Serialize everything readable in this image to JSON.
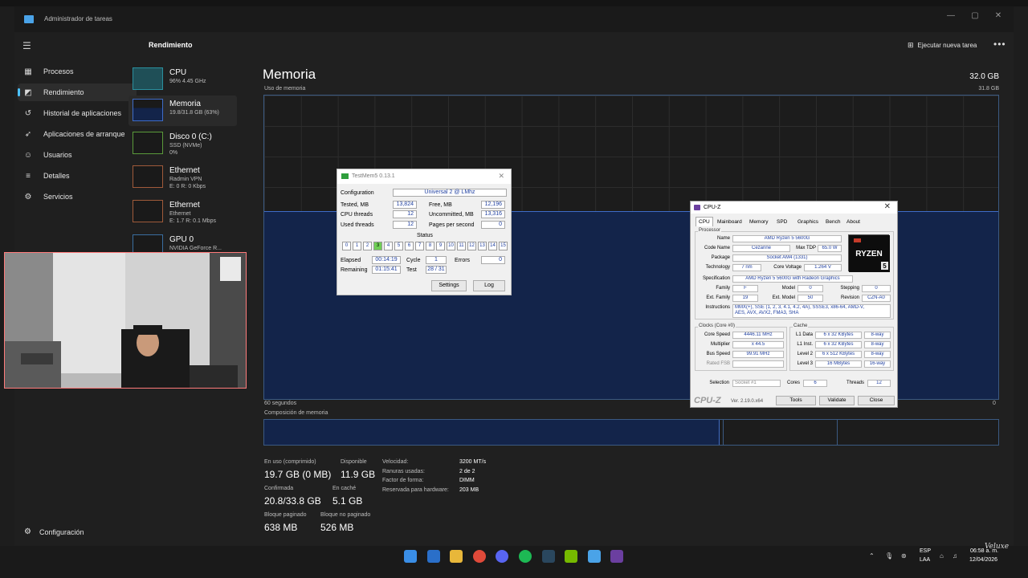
{
  "window": {
    "title": "Administrador de tareas",
    "minimize": "—",
    "maximize": "▢",
    "close": "✕"
  },
  "nav": {
    "items": [
      {
        "label": "Procesos",
        "icon": "processes-icon"
      },
      {
        "label": "Rendimiento",
        "icon": "performance-icon",
        "active": true
      },
      {
        "label": "Historial de aplicaciones",
        "icon": "history-icon"
      },
      {
        "label": "Aplicaciones de arranque",
        "icon": "startup-icon"
      },
      {
        "label": "Usuarios",
        "icon": "users-icon"
      },
      {
        "label": "Detalles",
        "icon": "details-icon"
      },
      {
        "label": "Servicios",
        "icon": "services-icon"
      }
    ],
    "settings": "Configuración"
  },
  "header": {
    "title": "Rendimiento",
    "run_task": "Ejecutar nueva tarea",
    "more": "•••"
  },
  "devices": [
    {
      "name": "CPU",
      "sub1": "96%  4.45 GHz",
      "sub2": "",
      "accent": "#2a8f9e"
    },
    {
      "name": "Memoria",
      "sub1": "19.8/31.8 GB (63%)",
      "sub2": "",
      "accent": "#3e6cc8"
    },
    {
      "name": "Disco 0 (C:)",
      "sub1": "SSD (NVMe)",
      "sub2": "0%",
      "accent": "#5a9a3a"
    },
    {
      "name": "Ethernet",
      "sub1": "Radmin VPN",
      "sub2": "E: 0 R: 0 Kbps",
      "accent": "#a05a3a"
    },
    {
      "name": "Ethernet",
      "sub1": "Ethernet",
      "sub2": "E: 1.7 R: 0.1 Mbps",
      "accent": "#a05a3a"
    },
    {
      "name": "GPU 0",
      "sub1": "NVIDIA GeForce R...",
      "sub2": "",
      "accent": "#3a6ea0"
    }
  ],
  "memory": {
    "title": "Memoria",
    "total": "32.0 GB",
    "usage_label": "Uso de memoria",
    "usage_max": "31.8 GB",
    "usage_fraction": 0.62,
    "time_left": "60 segundos",
    "time_right": "0",
    "composition_label": "Composición de memoria",
    "composition": {
      "in_use": 0.62,
      "modified": 0.006,
      "standby": 0.155
    },
    "stats": {
      "in_use_label": "En uso (comprimido)",
      "in_use": "19.7 GB (0 MB)",
      "available_label": "Disponible",
      "available": "11.9 GB",
      "committed_label": "Confirmada",
      "committed": "20.8/33.8 GB",
      "cached_label": "En caché",
      "cached": "5.1 GB",
      "paged_label": "Bloque paginado",
      "paged": "638 MB",
      "nonpaged_label": "Bloque no paginado",
      "nonpaged": "526 MB"
    },
    "props": [
      {
        "k": "Velocidad:",
        "v": "3200 MT/s"
      },
      {
        "k": "Ranuras usadas:",
        "v": "2 de 2"
      },
      {
        "k": "Factor de forma:",
        "v": "DIMM"
      },
      {
        "k": "Reservada para hardware:",
        "v": "203 MB"
      }
    ]
  },
  "testmem": {
    "title": "TestMem5  0.13.1",
    "configuration_label": "Configuration",
    "configuration": "Universal 2 @ LMhz",
    "tested_label": "Tested, MB",
    "tested": "13,824",
    "free_label": "Free, MB",
    "free": "12,196",
    "cpu_threads_label": "CPU threads",
    "cpu_threads": "12",
    "uncommitted_label": "Uncommitted, MB",
    "uncommitted": "13,316",
    "used_threads_label": "Used threads",
    "used_threads": "12",
    "pages_label": "Pages per second",
    "pages": "0",
    "status_label": "Status",
    "cells": [
      "0",
      "1",
      "2",
      "3",
      "4",
      "5",
      "6",
      "7",
      "8",
      "9",
      "10",
      "11",
      "12",
      "13",
      "14",
      "15"
    ],
    "active_cell": 3,
    "elapsed_label": "Elapsed",
    "elapsed": "00:14:19",
    "cycle_label": "Cycle",
    "cycle": "1",
    "errors_label": "Errors",
    "errors": "0",
    "remaining_label": "Remaining",
    "remaining": "01:15:41",
    "test_label": "Test",
    "test": "28 / 31",
    "settings_btn": "Settings",
    "log_btn": "Log"
  },
  "cpuz": {
    "title": "CPU-Z",
    "tabs": [
      "CPU",
      "Mainboard",
      "Memory",
      "SPD",
      "Graphics",
      "Bench",
      "About"
    ],
    "processor_label": "Processor",
    "name_k": "Name",
    "name": "AMD Ryzen 5 5600G",
    "codename_k": "Code Name",
    "codename": "Cezanne",
    "maxtdp_k": "Max TDP",
    "maxtdp": "65.0 W",
    "package_k": "Package",
    "package": "Socket AM4 (1331)",
    "technology_k": "Technology",
    "technology": "7 nm",
    "voltage_k": "Core Voltage",
    "voltage": "1.264 V",
    "spec_k": "Specification",
    "spec": "AMD Ryzen 5 5600G with Radeon Graphics",
    "family_k": "Family",
    "family": "F",
    "model_k": "Model",
    "model": "0",
    "stepping_k": "Stepping",
    "stepping": "0",
    "extfamily_k": "Ext. Family",
    "extfamily": "19",
    "extmodel_k": "Ext. Model",
    "extmodel": "50",
    "revision_k": "Revision",
    "revision": "CZN-A0",
    "instr_k": "Instructions",
    "instr1": "MMX(+), SSE (1, 2, 3, 4.1, 4.2, 4A), SSSE3, x86-64, AMD-V,",
    "instr2": "AES, AVX, AVX2, FMA3, SHA",
    "clocks_label": "Clocks (Core #0)",
    "corespeed_k": "Core Speed",
    "corespeed": "4446.11 MHz",
    "multiplier_k": "Multiplier",
    "multiplier": "x 44.5",
    "busspeed_k": "Bus Speed",
    "busspeed": "99.91 MHz",
    "ratedfsb_k": "Rated FSB",
    "ratedfsb": "",
    "cache_label": "Cache",
    "l1d_k": "L1 Data",
    "l1d": "6 x 32 KBytes",
    "l1d_w": "8-way",
    "l1i_k": "L1 Inst.",
    "l1i": "6 x 32 KBytes",
    "l1i_w": "8-way",
    "l2_k": "Level 2",
    "l2": "6 x 512 KBytes",
    "l2_w": "8-way",
    "l3_k": "Level 3",
    "l3": "16 MBytes",
    "l3_w": "16-way",
    "selection_k": "Selection",
    "selection": "Socket #1",
    "cores_k": "Cores",
    "cores": "6",
    "threads_k": "Threads",
    "threads": "12",
    "brand": "CPU-Z",
    "version": "Ver. 2.19.0.x64",
    "tools_btn": "Tools",
    "validate_btn": "Validate",
    "close_btn": "Close",
    "logo_text": "RYZEN",
    "logo_num": "5"
  },
  "taskbar": {
    "lang1": "ESP",
    "lang2": "LAA",
    "time": "06:58 a. m.",
    "date": "12/04/2026",
    "mark": "Veluxe"
  }
}
